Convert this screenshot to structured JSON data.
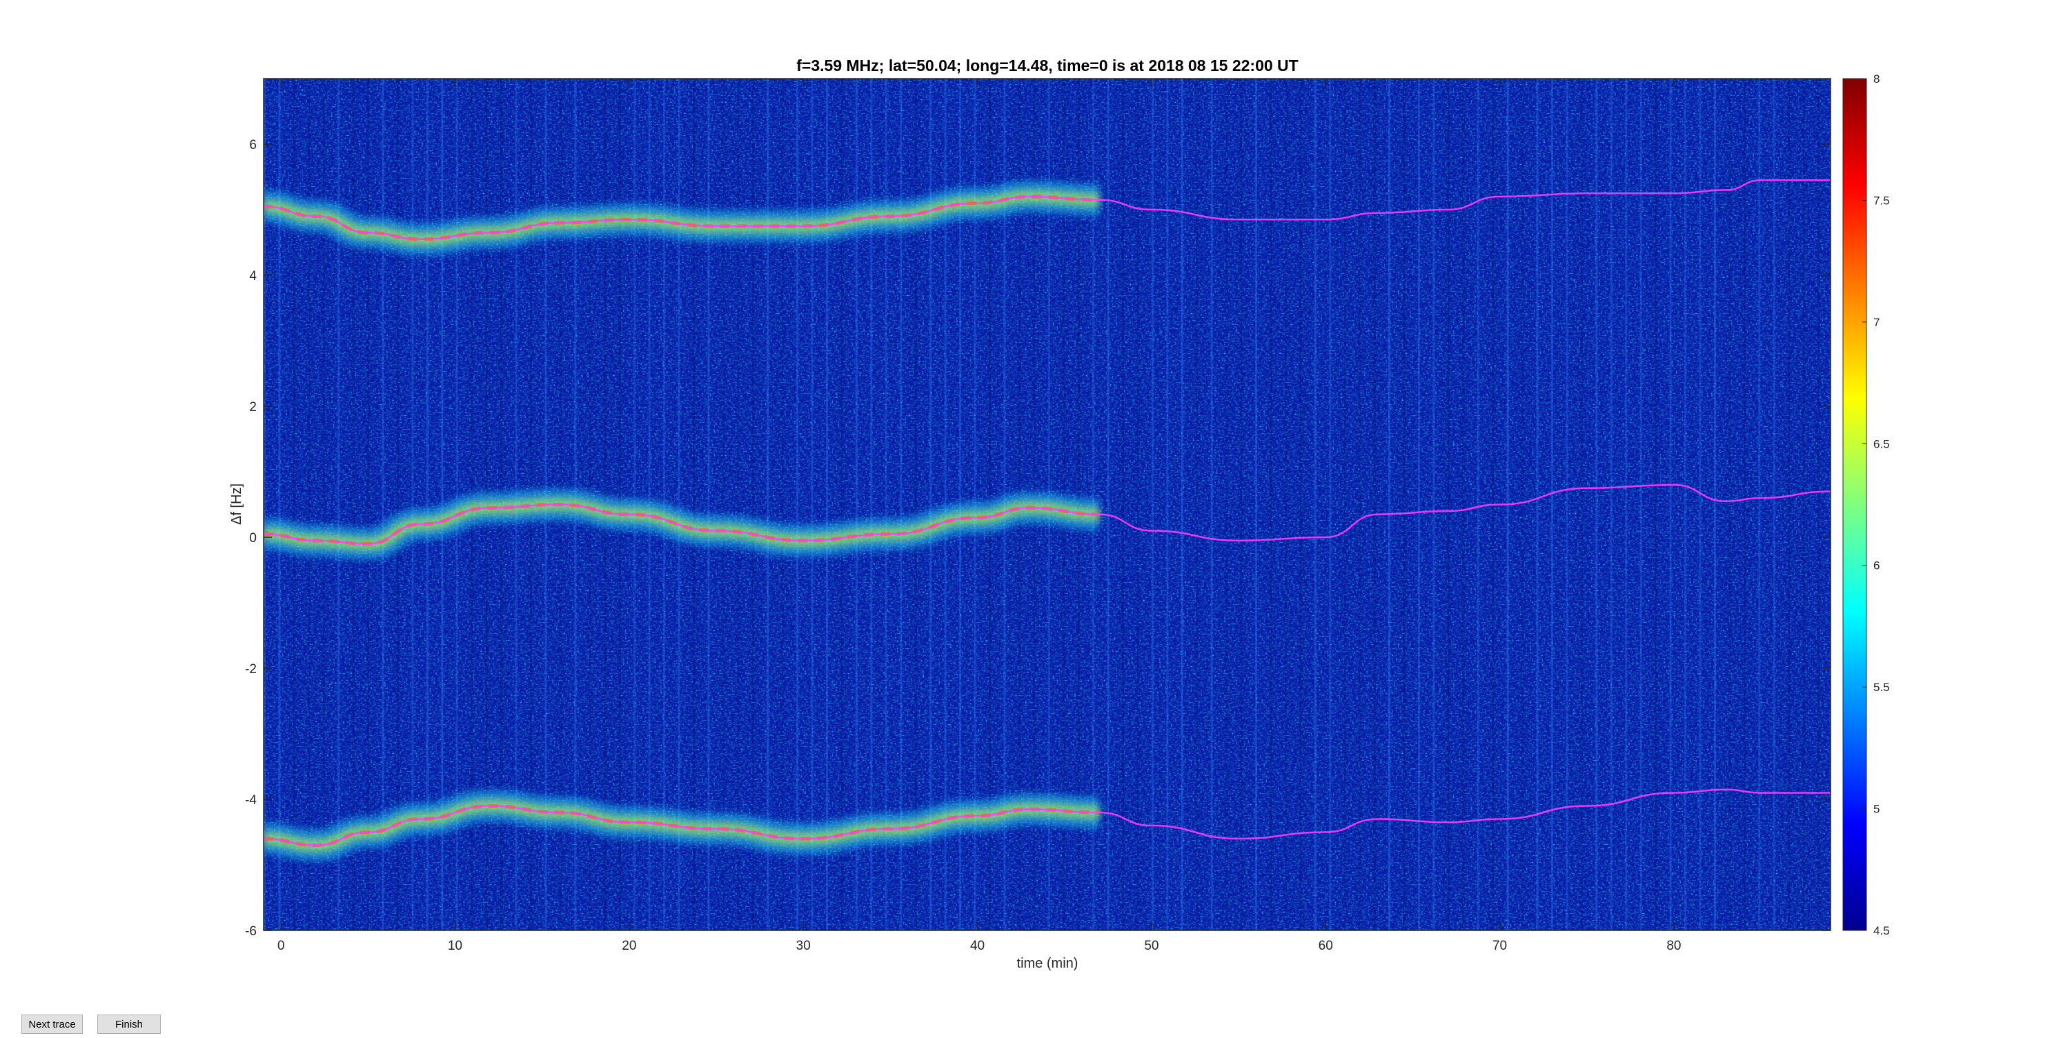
{
  "window": {
    "buttons": {
      "next_trace": "Next trace",
      "finish": "Finish"
    }
  },
  "chart_data": {
    "type": "heatmap",
    "title": "f=3.59 MHz;  lat=50.04; long=14.48, time=0 is at 2018 08 15 22:00 UT",
    "xlabel": "time (min)",
    "ylabel": "Δf [Hz]",
    "xlim": [
      -1,
      89
    ],
    "ylim": [
      -6,
      7
    ],
    "xticks": [
      0,
      10,
      20,
      30,
      40,
      50,
      60,
      70,
      80
    ],
    "yticks": [
      -6,
      -4,
      -2,
      0,
      2,
      4,
      6
    ],
    "colorbar": {
      "range": [
        4.5,
        8
      ],
      "ticks": [
        4.5,
        5,
        5.5,
        6,
        6.5,
        7,
        7.5,
        8
      ],
      "colormap": "jet"
    },
    "background_color": "#0a1aa8",
    "traces": [
      {
        "name": "",
        "x": [
          -1,
          2,
          5,
          8,
          12,
          16,
          20,
          25,
          30,
          35,
          40,
          43,
          47,
          50,
          55,
          60,
          63,
          67,
          70,
          75,
          80,
          83,
          85,
          89
        ],
        "y": [
          5.05,
          4.9,
          4.65,
          4.55,
          4.65,
          4.8,
          4.85,
          4.75,
          4.75,
          4.9,
          5.1,
          5.2,
          5.15,
          5.0,
          4.85,
          4.85,
          4.95,
          5.0,
          5.2,
          5.25,
          5.25,
          5.3,
          5.45,
          5.45
        ],
        "bright_until": 47
      },
      {
        "name": "",
        "x": [
          -1,
          2,
          5,
          8,
          12,
          16,
          20,
          25,
          30,
          35,
          40,
          43,
          47,
          50,
          55,
          60,
          63,
          67,
          70,
          75,
          80,
          83,
          85,
          89
        ],
        "y": [
          0.05,
          -0.05,
          -0.1,
          0.2,
          0.45,
          0.5,
          0.35,
          0.1,
          -0.05,
          0.05,
          0.3,
          0.45,
          0.35,
          0.1,
          -0.05,
          0.0,
          0.35,
          0.4,
          0.5,
          0.75,
          0.8,
          0.55,
          0.6,
          0.7
        ],
        "bright_until": 47
      },
      {
        "name": "",
        "x": [
          -1,
          2,
          5,
          8,
          12,
          16,
          20,
          25,
          30,
          35,
          40,
          43,
          47,
          50,
          55,
          60,
          63,
          67,
          70,
          75,
          80,
          83,
          85,
          89
        ],
        "y": [
          -4.6,
          -4.7,
          -4.5,
          -4.3,
          -4.1,
          -4.2,
          -4.35,
          -4.45,
          -4.6,
          -4.45,
          -4.25,
          -4.15,
          -4.2,
          -4.4,
          -4.6,
          -4.5,
          -4.3,
          -4.35,
          -4.3,
          -4.1,
          -3.9,
          -3.85,
          -3.9,
          -3.9
        ],
        "bright_until": 47
      }
    ]
  }
}
